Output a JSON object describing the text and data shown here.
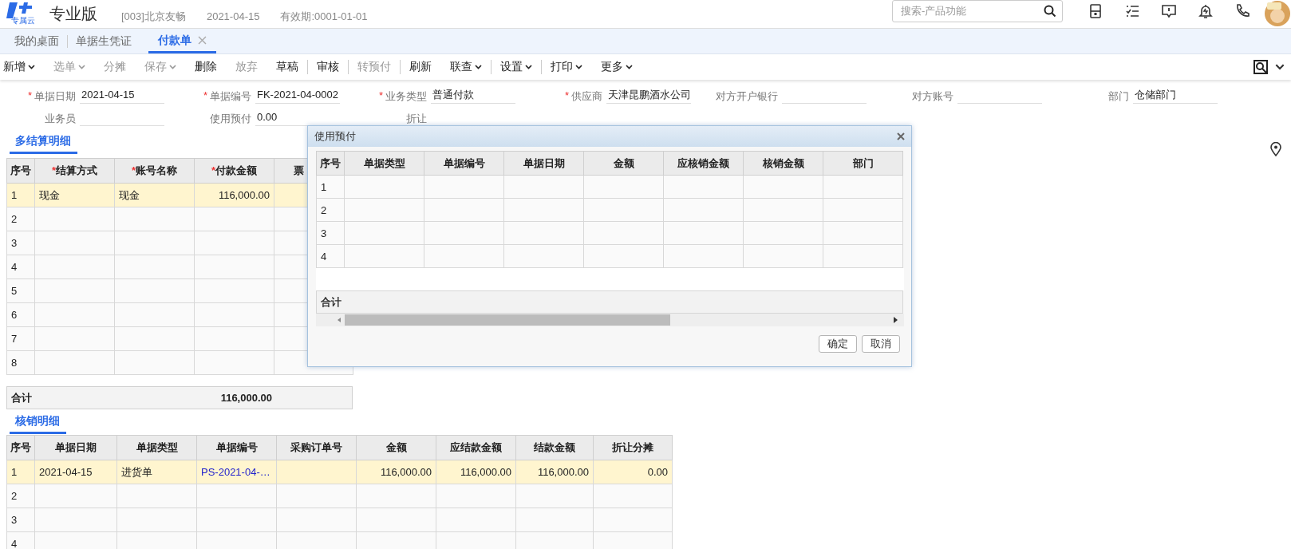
{
  "header": {
    "logo_caption": "专属云",
    "product": "专业版",
    "account": "[003]北京友畅",
    "date": "2021-04-15",
    "validity": "有效期:0001-01-01",
    "search": {
      "placeholder": "搜索-产品功能"
    }
  },
  "tabs": [
    {
      "label": "我的桌面",
      "selected": false,
      "closable": false
    },
    {
      "label": "单据生凭证",
      "selected": false,
      "closable": false
    },
    {
      "label": "付款单",
      "selected": true,
      "closable": true
    }
  ],
  "toolbar": [
    {
      "label": "新增",
      "dropdown": true,
      "disabled": false,
      "separator_after": false
    },
    {
      "label": "选单",
      "dropdown": true,
      "disabled": true,
      "separator_after": false
    },
    {
      "label": "分摊",
      "dropdown": false,
      "disabled": true,
      "separator_after": false
    },
    {
      "label": "保存",
      "dropdown": true,
      "disabled": true,
      "separator_after": false
    },
    {
      "label": "删除",
      "dropdown": false,
      "disabled": false,
      "separator_after": false
    },
    {
      "label": "放弃",
      "dropdown": false,
      "disabled": true,
      "separator_after": false
    },
    {
      "label": "草稿",
      "dropdown": false,
      "disabled": false,
      "separator_after": true
    },
    {
      "label": "审核",
      "dropdown": false,
      "disabled": false,
      "separator_after": true
    },
    {
      "label": "转预付",
      "dropdown": false,
      "disabled": true,
      "separator_after": true
    },
    {
      "label": "刷新",
      "dropdown": false,
      "disabled": false,
      "separator_after": false
    },
    {
      "label": "联查",
      "dropdown": true,
      "disabled": false,
      "separator_after": true
    },
    {
      "label": "设置",
      "dropdown": true,
      "disabled": false,
      "separator_after": true
    },
    {
      "label": "打印",
      "dropdown": true,
      "disabled": false,
      "separator_after": false
    },
    {
      "label": "更多",
      "dropdown": true,
      "disabled": false,
      "separator_after": false
    }
  ],
  "form": {
    "fields": [
      {
        "label": "单据日期",
        "mark": "*",
        "value": "2021-04-15"
      },
      {
        "label": "单据编号",
        "mark": "*",
        "value": "FK-2021-04-0002"
      },
      {
        "label": "业务类型",
        "mark": "*",
        "value": "普通付款"
      },
      {
        "label": "供应商",
        "mark": "*",
        "value": "天津昆鹏酒水公司"
      },
      {
        "label": "对方开户银行"
      },
      {
        "label": "对方账号"
      },
      {
        "label": "部门",
        "value": "仓储部门"
      },
      {
        "label": "业务员"
      },
      {
        "label": "使用预付",
        "value": "0.00"
      },
      {
        "label": "折让"
      }
    ]
  },
  "settlement": {
    "title": "多结算明细",
    "columns": [
      {
        "label": "序号",
        "kind": "index"
      },
      {
        "label": "结算方式",
        "mark": "*",
        "kind": "text"
      },
      {
        "label": "账号名称",
        "mark": "*",
        "kind": "text"
      },
      {
        "label": "付款金额",
        "mark": "*",
        "kind": "number"
      },
      {
        "label": "票",
        "kind": "text"
      }
    ],
    "rows": [
      {
        "no": "1",
        "selected": true,
        "cells": [
          "现金",
          "现金",
          "116,000.00",
          null
        ]
      },
      {
        "no": "2",
        "selected": false
      },
      {
        "no": "3",
        "selected": false
      },
      {
        "no": "4",
        "selected": false
      },
      {
        "no": "5",
        "selected": false
      },
      {
        "no": "6",
        "selected": false
      },
      {
        "no": "7",
        "selected": false
      },
      {
        "no": "8",
        "selected": false
      }
    ],
    "total": {
      "label": "合计",
      "amount": "116,000.00"
    }
  },
  "writeoff": {
    "title": "核销明细",
    "columns": [
      {
        "label": "序号",
        "kind": "index"
      },
      {
        "label": "单据日期",
        "kind": "text"
      },
      {
        "label": "单据类型",
        "kind": "text"
      },
      {
        "label": "单据编号",
        "kind": "link"
      },
      {
        "label": "采购订单号",
        "kind": "text"
      },
      {
        "label": "金额",
        "kind": "number"
      },
      {
        "label": "应结款金额",
        "kind": "number"
      },
      {
        "label": "结款金额",
        "kind": "number"
      },
      {
        "label": "折让分摊",
        "kind": "number"
      }
    ],
    "rows": [
      {
        "no": "1",
        "selected": true,
        "cells": [
          "2021-04-15",
          "进货单",
          "PS-2021-04-…",
          null,
          "116,000.00",
          "116,000.00",
          "116,000.00",
          "0.00"
        ]
      },
      {
        "no": "2",
        "selected": false
      },
      {
        "no": "3",
        "selected": false
      },
      {
        "no": "4",
        "selected": false
      }
    ]
  },
  "dialog": {
    "title": "使用预付",
    "columns": [
      {
        "label": "序号",
        "kind": "index"
      },
      {
        "label": "单据类型",
        "kind": "text"
      },
      {
        "label": "单据编号",
        "kind": "text"
      },
      {
        "label": "单据日期",
        "kind": "text"
      },
      {
        "label": "金额",
        "kind": "number"
      },
      {
        "label": "应核销金额",
        "kind": "number"
      },
      {
        "label": "核销金额",
        "kind": "number"
      },
      {
        "label": "部门",
        "kind": "text"
      }
    ],
    "rows": [
      {
        "no": "1",
        "selected": false
      },
      {
        "no": "2",
        "selected": false
      },
      {
        "no": "3",
        "selected": false
      },
      {
        "no": "4",
        "selected": false
      }
    ],
    "total_label": "合计",
    "buttons": [
      {
        "label": "确定"
      },
      {
        "label": "取消"
      }
    ]
  }
}
